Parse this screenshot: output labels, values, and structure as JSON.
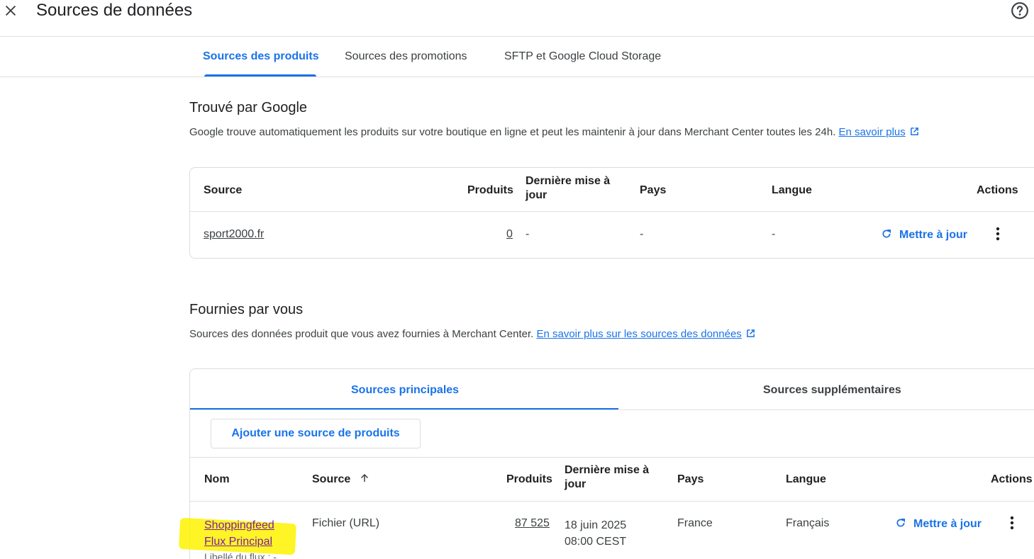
{
  "header": {
    "title": "Sources de données",
    "close_icon": "close-icon",
    "help_icon": "help-icon"
  },
  "tabs": [
    {
      "label": "Sources des produits",
      "active": true
    },
    {
      "label": "Sources des promotions",
      "active": false
    },
    {
      "label": "SFTP et Google Cloud Storage",
      "active": false
    }
  ],
  "found_by_google": {
    "title": "Trouvé par Google",
    "description": "Google trouve automatiquement les produits sur votre boutique en ligne et peut les maintenir à jour dans Merchant Center toutes les 24h.",
    "link_label": "En savoir plus",
    "columns": {
      "source": "Source",
      "products": "Produits",
      "last_update_1": "Dernière mise à",
      "last_update_2": "jour",
      "country": "Pays",
      "language": "Langue",
      "actions": "Actions"
    },
    "row": {
      "source": "sport2000.fr",
      "products": "0",
      "last_update": "-",
      "country": "-",
      "language": "-",
      "action_label": "Mettre à jour"
    }
  },
  "provided_by_you": {
    "title": "Fournies par vous",
    "description": "Sources des données produit que vous avez fournies à Merchant Center.",
    "link_label": "En savoir plus sur les sources des données",
    "subtabs": [
      {
        "label": "Sources principales",
        "active": true
      },
      {
        "label": "Sources supplémentaires",
        "active": false
      }
    ],
    "add_button": "Ajouter une source de produits",
    "columns": {
      "name": "Nom",
      "source": "Source",
      "products": "Produits",
      "last_update_1": "Dernière mise à",
      "last_update_2": "jour",
      "country": "Pays",
      "language": "Langue",
      "actions": "Actions"
    },
    "row": {
      "name_line1": "Shoppingfeed",
      "name_line2": "Flux Principal",
      "feed_label": "Libellé du flux : -",
      "source": "Fichier (URL)",
      "products": "87 525",
      "date": "18 juin 2025",
      "time": "08:00 CEST",
      "country": "France",
      "language": "Français",
      "action_label": "Mettre à jour"
    }
  },
  "colors": {
    "accent": "#1a73e8",
    "visited_link": "#7b1fa2",
    "highlight": "#fff200"
  }
}
